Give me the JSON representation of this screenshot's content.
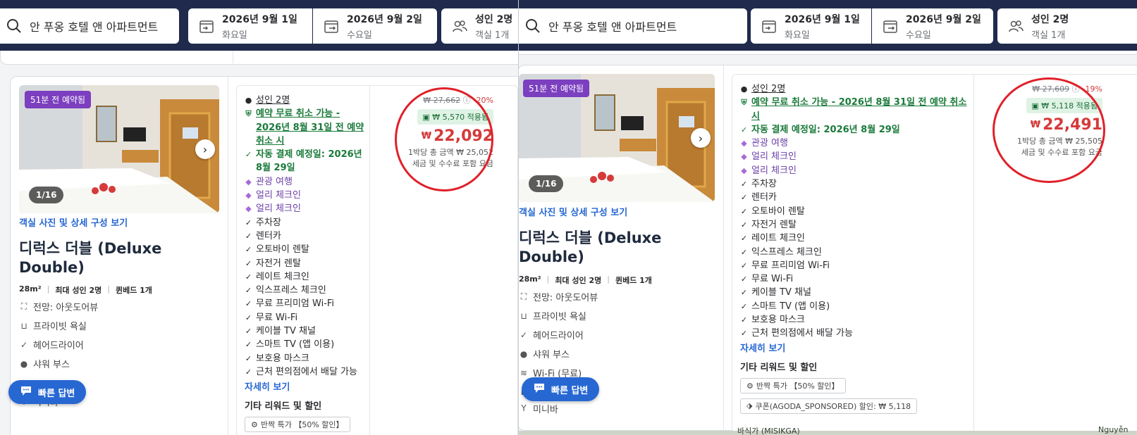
{
  "search": {
    "query": "안 푸옹 호텔 앤 아파트먼트",
    "checkin_date": "2026년 9월 1일",
    "checkin_day": "화요일",
    "checkout_date": "2026년 9월 2일",
    "checkout_day": "수요일",
    "guests_left": "성인 2명",
    "rooms_left": "객실 1개",
    "guests_right": "성인 2명",
    "rooms_right": "객실 1개"
  },
  "room": {
    "booked_badge": "51분 전 예약됨",
    "photo_count_left": "1/16",
    "photo_count_right": "1/16",
    "photo_link": "객실 사진 및 상세 구성 보기",
    "title": "디럭스 더블 (Deluxe Double)",
    "size": "28m²",
    "max_guests": "최대 성인 2명",
    "bed": "퀸베드 1개",
    "features_left": [
      "전망: 아웃도어뷰",
      "프라이빗 욕실",
      "헤어드라이어",
      "샤워 부스",
      "",
      "미니바"
    ],
    "features_right": [
      "전망: 아웃도어뷰",
      "프라이빗 욕실",
      "헤어드라이어",
      "샤워 부스",
      "Wi-Fi (무료)",
      "",
      "미니바"
    ]
  },
  "benefits": {
    "people": "성인 2명",
    "free_cancel": "예약 무료 취소 가능 - 2026년 8월 31일 전 예약 취소 시",
    "auto_pay": "자동 결제 예정일: 2026년 8월 29일",
    "tour": "관광 여행",
    "early1": "얼리 체크인",
    "early2": "얼리 체크인",
    "items": [
      "주차장",
      "렌터카",
      "오토바이 렌탈",
      "자전거 렌탈",
      "레이트 체크인",
      "익스프레스 체크인",
      "무료 프리미엄 Wi-Fi",
      "무료 Wi-Fi",
      "케이블 TV 채널",
      "스마트 TV (앱 이용)",
      "보호용 마스크",
      "근처 편의점에서 배달 가능"
    ],
    "more": "자세히 보기",
    "other_head": "기타 리워드 및 할인",
    "pill1": "반짝 특가 【50% 할인】",
    "pill2": "쿠폰(AGODA_SPONSORED) 할인: ₩ 5,118"
  },
  "price_left": {
    "strike": "₩ 27,662",
    "discount": "-20%",
    "applied": "₩ 5,570 적용됨",
    "currency": "₩",
    "amount": "22,092",
    "total": "1박당 총 금액 ₩ 25,052",
    "note": "세금 및 수수료 포함 요금"
  },
  "price_right": {
    "strike": "₩ 27,609",
    "discount": "-19%",
    "applied": "₩ 5,118 적용됨",
    "currency": "₩",
    "amount": "22,491",
    "total": "1박당 총 금액 ₩ 25,505",
    "note": "세금 및 수수료 포함 요금"
  },
  "quick_reply": "빠른 답변",
  "map": {
    "label1": "바식가 (MISIKGA)",
    "label2": "Nguyễn"
  },
  "colors": {
    "brand_navy": "#1f2a4d",
    "price_red": "#d43a3a",
    "link_blue": "#2767d2",
    "green": "#1a7a3a",
    "purple": "#6b3fa8",
    "highlight_circle": "#e0202a"
  }
}
